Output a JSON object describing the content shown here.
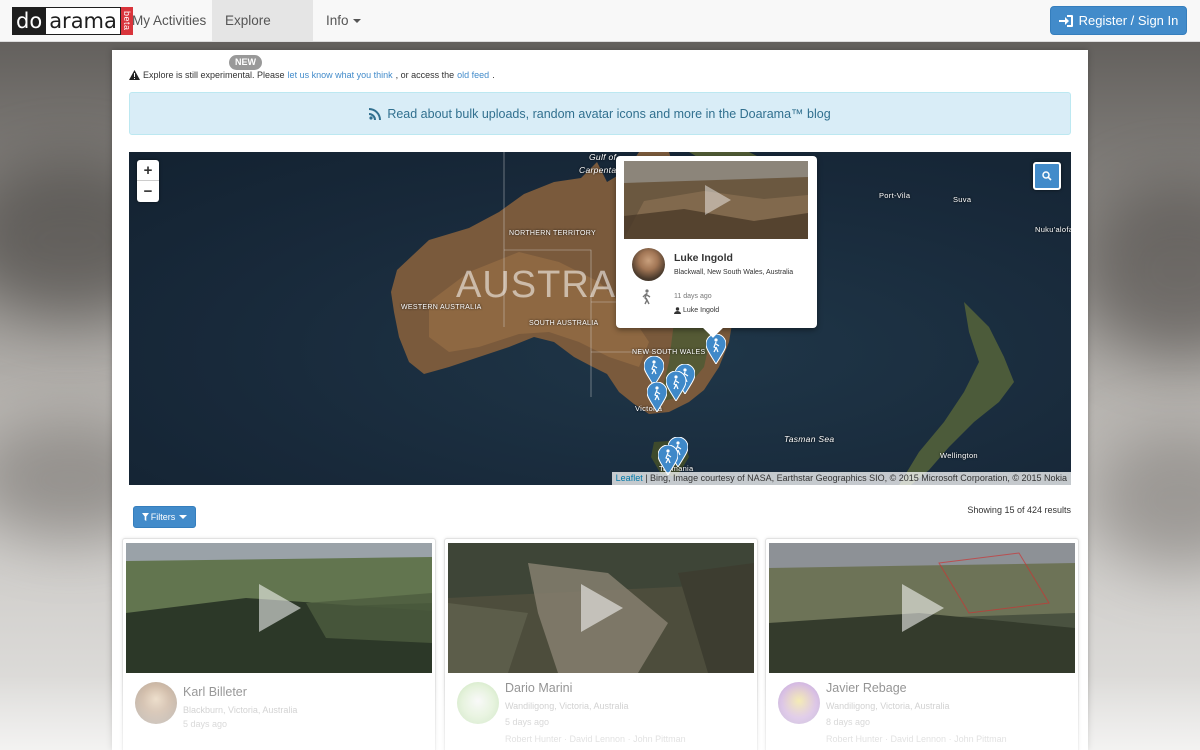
{
  "colors": {
    "primary": "#428bca",
    "logo_beta_red": "#d9343b",
    "info_bg": "#d9edf7",
    "info_text": "#31708f",
    "link": "#428bca"
  },
  "navbar": {
    "logo": {
      "do": "do",
      "arama": "arama",
      "badge": "beta"
    },
    "items": [
      {
        "label": "My Activities"
      },
      {
        "label": "Explore",
        "badge": "NEW"
      },
      {
        "label": "Info"
      }
    ],
    "register_label": "Register / Sign In",
    "register_icon": "sign-in-icon"
  },
  "notice": {
    "prefix": "Explore is still experimental. Please",
    "link1": "let us know what you think",
    "middle": ", or access the",
    "link2": "old feed",
    "suffix": ".",
    "icon": "warning-icon"
  },
  "blog_banner": {
    "icon": "rss-icon",
    "text": "Read about bulk uploads, random avatar icons and more in the Doarama™ blog"
  },
  "map": {
    "zoom_in": "+",
    "zoom_out": "−",
    "search_icon": "search-icon",
    "big_label": "AUSTRALIA",
    "labels": {
      "gulf": "Gulf of",
      "carpentaria": "Carpentaria",
      "northern_territory": "Northern Territory",
      "western_australia": "Western Australia",
      "south_australia": "South Australia",
      "nsw": "New South Wales",
      "victoria": "Victoria",
      "tasmania": "Tasmania",
      "tasman_sea": "Tasman Sea",
      "port_vila": "Port-Vila",
      "suva": "Suva",
      "nukualofa": "Nuku'alofa",
      "wellington": "Wellington"
    },
    "attribution": {
      "leaflet": "Leaflet",
      "text": " | Bing, Image courtesy of NASA, Earthstar Geographics SIO, © 2015 Microsoft Corporation, © 2015 Nokia"
    },
    "popup": {
      "name": "Luke Ingold",
      "location": "Blackwall, New South Wales, Australia",
      "age": "11 days ago",
      "user": "Luke Ingold",
      "activity_icon": "walking-icon"
    }
  },
  "filters": {
    "label": "Filters"
  },
  "results": {
    "text": "Showing 15 of 424 results"
  },
  "cards": [
    {
      "name": "Karl Billeter",
      "location": "Blackburn, Victoria, Australia",
      "age": "5 days ago",
      "users": ""
    },
    {
      "name": "Dario Marini",
      "location": "Wandiligong, Victoria, Australia",
      "age": "5 days ago",
      "users": "Robert Hunter · David Lennon · John Pittman"
    },
    {
      "name": "Javier Rebage",
      "location": "Wandiligong, Victoria, Australia",
      "age": "8 days ago",
      "users": "Robert Hunter · David Lennon · John Pittman"
    }
  ]
}
